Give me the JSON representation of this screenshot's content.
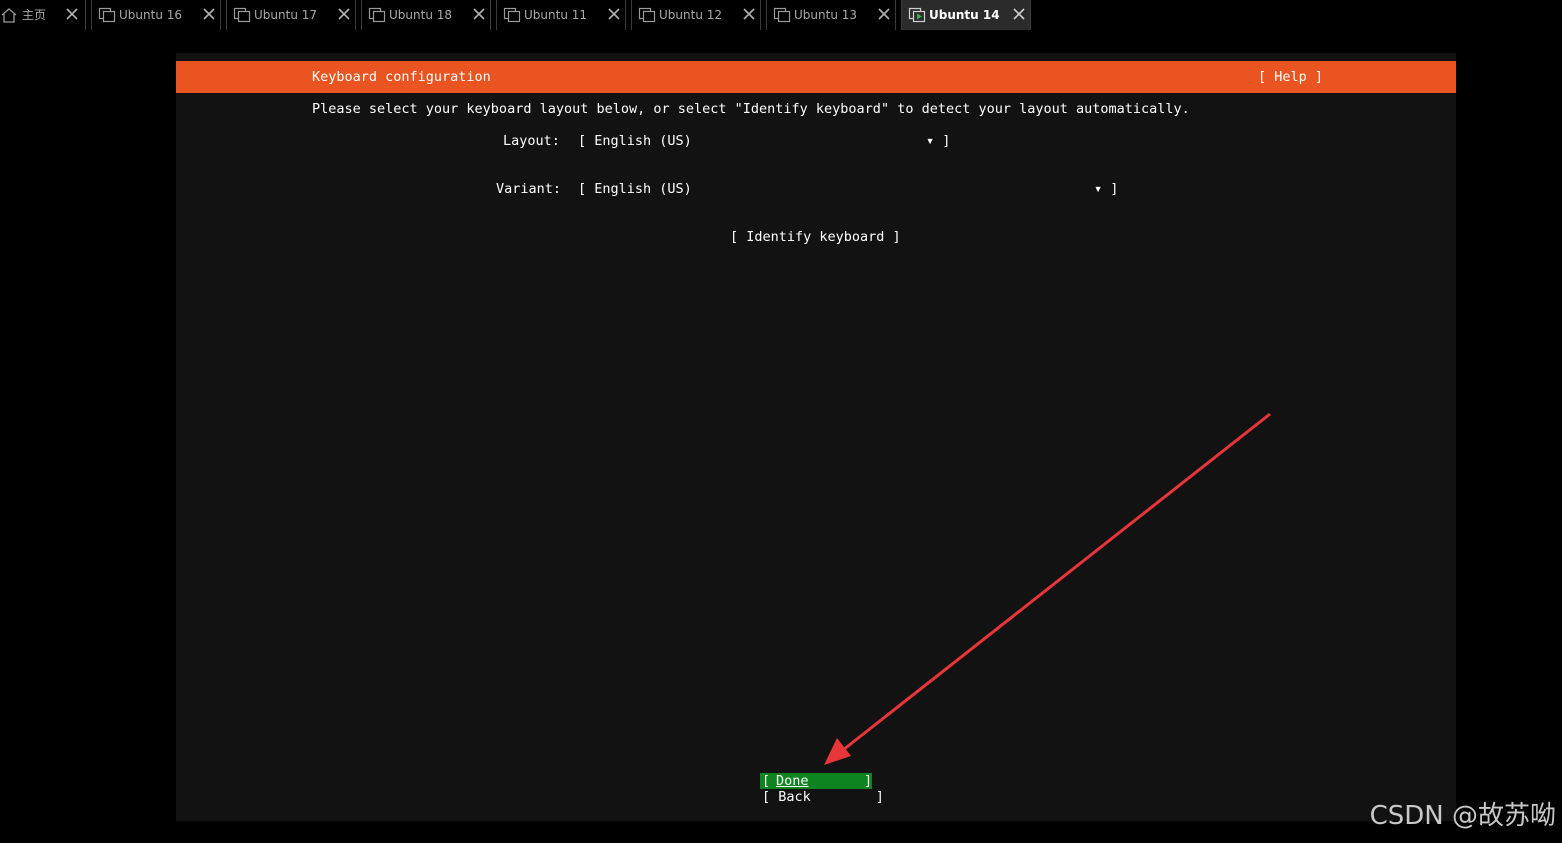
{
  "tabs": [
    {
      "label": "主页",
      "icon": "home-icon",
      "active": false
    },
    {
      "label": "Ubuntu 16",
      "icon": "vm-icon",
      "active": false
    },
    {
      "label": "Ubuntu 17",
      "icon": "vm-icon",
      "active": false
    },
    {
      "label": "Ubuntu 18",
      "icon": "vm-icon",
      "active": false
    },
    {
      "label": "Ubuntu 11",
      "icon": "vm-icon",
      "active": false
    },
    {
      "label": "Ubuntu 12",
      "icon": "vm-icon",
      "active": false
    },
    {
      "label": "Ubuntu 13",
      "icon": "vm-icon",
      "active": false
    },
    {
      "label": "Ubuntu 14",
      "icon": "vm-running-icon",
      "active": true
    }
  ],
  "installer": {
    "title": "Keyboard configuration",
    "help": "[ Help ]",
    "instructions": "Please select your keyboard layout below, or select \"Identify keyboard\" to detect your layout automatically.",
    "layout_label": "Layout:",
    "layout_value": "[ English (US)",
    "layout_end": "▾ ]",
    "variant_label": "Variant:",
    "variant_value": "[ English (US)",
    "variant_end": "▾ ]",
    "identify": "[ Identify keyboard ]",
    "done_open": "[ ",
    "done_label": "Done",
    "done_close": "]",
    "back": "[ Back        ]"
  },
  "colors": {
    "header": "#e95420",
    "done_bg": "#0e8420",
    "arrow": "#e8353a",
    "active_tab_icon": "#3cb34a"
  },
  "watermark": "CSDN @故苏呦"
}
